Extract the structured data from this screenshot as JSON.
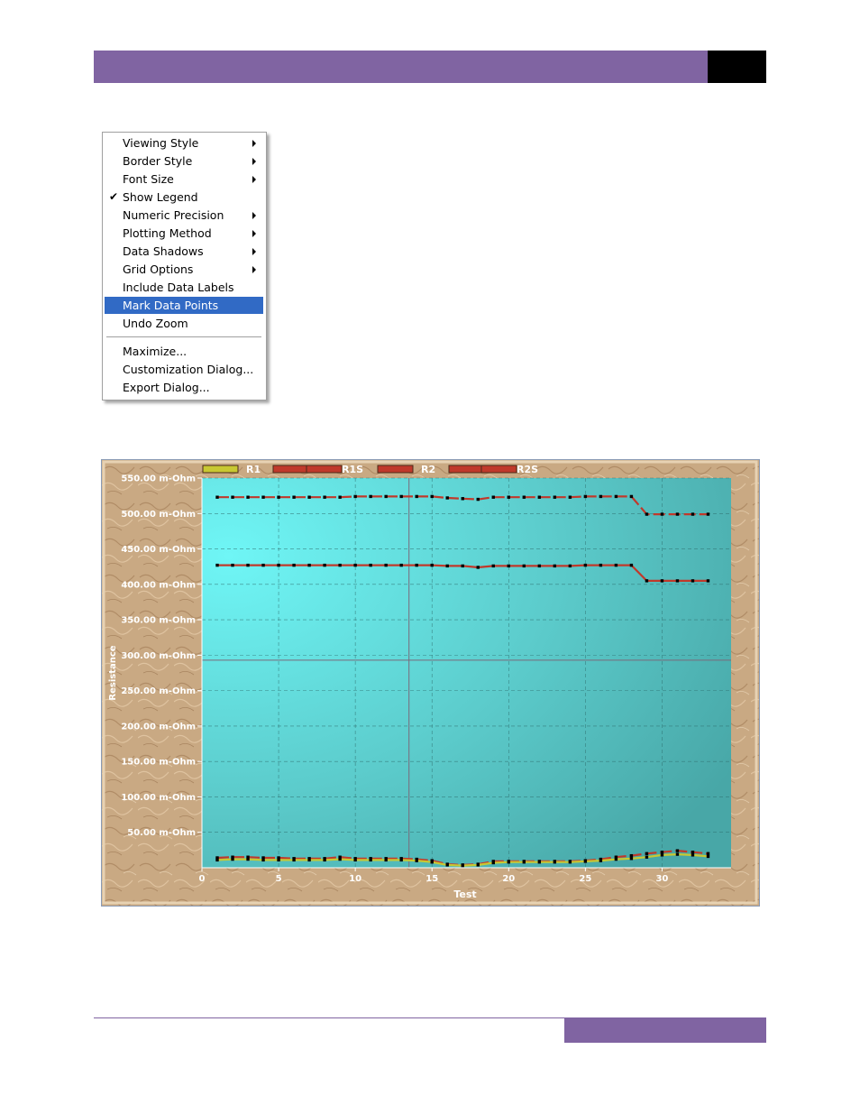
{
  "context_menu": {
    "items": [
      {
        "label": "Viewing Style",
        "submenu": true,
        "checked": false,
        "highlighted": false
      },
      {
        "label": "Border Style",
        "submenu": true,
        "checked": false,
        "highlighted": false
      },
      {
        "label": "Font Size",
        "submenu": true,
        "checked": false,
        "highlighted": false
      },
      {
        "label": "Show Legend",
        "submenu": false,
        "checked": true,
        "highlighted": false
      },
      {
        "label": "Numeric Precision",
        "submenu": true,
        "checked": false,
        "highlighted": false
      },
      {
        "label": "Plotting Method",
        "submenu": true,
        "checked": false,
        "highlighted": false
      },
      {
        "label": "Data Shadows",
        "submenu": true,
        "checked": false,
        "highlighted": false
      },
      {
        "label": "Grid Options",
        "submenu": true,
        "checked": false,
        "highlighted": false
      },
      {
        "label": "Include Data Labels",
        "submenu": false,
        "checked": false,
        "highlighted": false
      },
      {
        "label": "Mark Data Points",
        "submenu": false,
        "checked": false,
        "highlighted": true
      },
      {
        "label": "Undo Zoom",
        "submenu": false,
        "checked": false,
        "highlighted": false
      },
      {
        "label": "Maximize...",
        "submenu": false,
        "checked": false,
        "highlighted": false
      },
      {
        "label": "Customization Dialog...",
        "submenu": false,
        "checked": false,
        "highlighted": false
      },
      {
        "label": "Export Dialog...",
        "submenu": false,
        "checked": false,
        "highlighted": false
      }
    ],
    "check_glyph": "✔"
  },
  "colors": {
    "header": "#8064a2",
    "menu_highlight": "#316ac5",
    "plot_bg_light": "#6ff6f6",
    "plot_bg_dark": "#48a7a7",
    "r1": "#c8c832",
    "r1s": "#c0392b",
    "r2": "#c0392b",
    "r2s": "#c0392b"
  },
  "chart_data": {
    "type": "line",
    "xlabel": "Test",
    "ylabel": "Resistance",
    "xlim": [
      0,
      34.5
    ],
    "ylim": [
      0,
      550
    ],
    "x_ticks": [
      0,
      5,
      10,
      15,
      20,
      25,
      30
    ],
    "y_ticks": [
      50,
      100,
      150,
      200,
      250,
      300,
      350,
      400,
      450,
      500,
      550
    ],
    "y_tick_labels": [
      "50.00 m-Ohm",
      "100.00 m-Ohm",
      "150.00 m-Ohm",
      "200.00 m-Ohm",
      "250.00 m-Ohm",
      "300.00 m-Ohm",
      "350.00 m-Ohm",
      "400.00 m-Ohm",
      "450.00 m-Ohm",
      "500.00 m-Ohm",
      "550.00 m-Ohm"
    ],
    "legend_position": "top-left",
    "grid": true,
    "cursor": {
      "x": 13.5,
      "y": 293
    },
    "x": [
      1,
      2,
      3,
      4,
      5,
      6,
      7,
      8,
      9,
      10,
      11,
      12,
      13,
      14,
      15,
      16,
      17,
      18,
      19,
      20,
      21,
      22,
      23,
      24,
      25,
      26,
      27,
      28,
      29,
      30,
      31,
      32,
      33
    ],
    "series": [
      {
        "name": "R1",
        "values": [
          11,
          12,
          12,
          11,
          11,
          11,
          11,
          11,
          12,
          11,
          11,
          11,
          11,
          10,
          8,
          4,
          3,
          4,
          7,
          8,
          8,
          8,
          8,
          8,
          9,
          10,
          12,
          13,
          15,
          18,
          19,
          18,
          16
        ]
      },
      {
        "name": "R1S",
        "values": [
          14,
          15,
          15,
          14,
          14,
          13,
          13,
          13,
          15,
          13,
          13,
          13,
          13,
          12,
          10,
          5,
          4,
          5,
          9,
          9,
          9,
          9,
          9,
          9,
          10,
          12,
          15,
          17,
          20,
          22,
          24,
          22,
          20
        ]
      },
      {
        "name": "R2",
        "values": [
          427,
          427,
          427,
          427,
          427,
          427,
          427,
          427,
          427,
          427,
          427,
          427,
          427,
          427,
          427,
          426,
          426,
          424,
          426,
          426,
          426,
          426,
          426,
          426,
          427,
          427,
          427,
          427,
          405,
          405,
          405,
          405,
          405
        ]
      },
      {
        "name": "R2S",
        "values": [
          523,
          523,
          523,
          523,
          523,
          523,
          523,
          523,
          523,
          524,
          524,
          524,
          524,
          524,
          524,
          522,
          521,
          520,
          523,
          523,
          523,
          523,
          523,
          523,
          524,
          524,
          524,
          524,
          499,
          499,
          499,
          499,
          499
        ]
      }
    ]
  }
}
